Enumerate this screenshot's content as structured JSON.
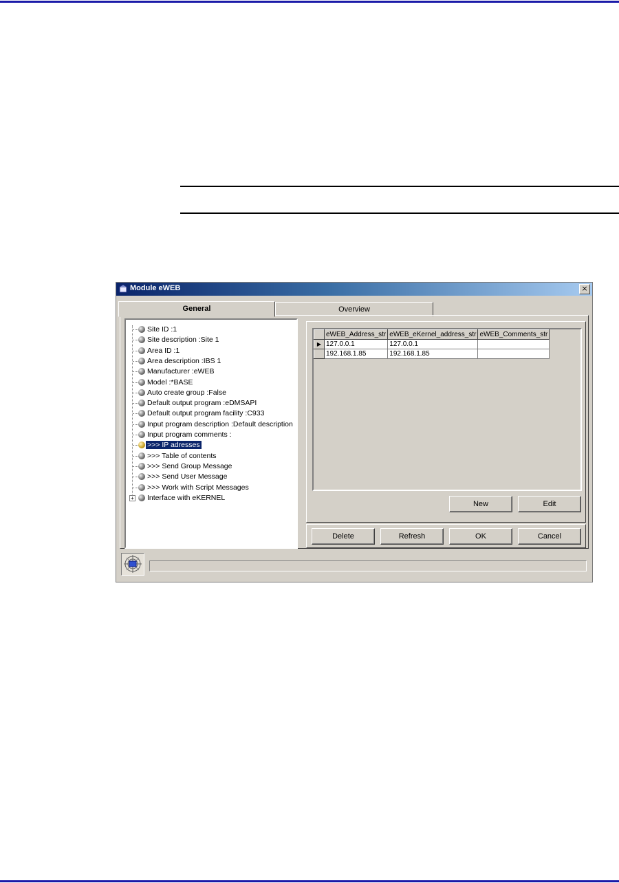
{
  "window": {
    "title": "Module eWEB",
    "close_glyph": "×"
  },
  "tabs": [
    {
      "label": "General",
      "active": true
    },
    {
      "label": "Overview",
      "active": false
    }
  ],
  "tree": {
    "items": [
      {
        "label": "Site ID :1"
      },
      {
        "label": "Site description :Site 1"
      },
      {
        "label": "Area ID :1"
      },
      {
        "label": "Area description :IBS 1"
      },
      {
        "label": "Manufacturer :eWEB"
      },
      {
        "label": "Model :*BASE"
      },
      {
        "label": "Auto create group :False"
      },
      {
        "label": "Default output program :eDMSAPI"
      },
      {
        "label": "Default output program facility :C933"
      },
      {
        "label": "Input program description :Default description"
      },
      {
        "label": "Input program comments :"
      },
      {
        "label": ">>> IP adresses",
        "selected": true
      },
      {
        "label": ">>> Table of contents"
      },
      {
        "label": ">>> Send Group Message"
      },
      {
        "label": ">>> Send User Message"
      },
      {
        "label": ">>> Work with Script Messages"
      },
      {
        "label": "Interface with eKERNEL",
        "expandable": true
      }
    ],
    "expand_glyph": "+"
  },
  "grid": {
    "columns": [
      "eWEB_Address_str",
      "eWEB_eKernel_address_str",
      "eWEB_Comments_str"
    ],
    "rows": [
      {
        "indicator": "▶",
        "cells": [
          "127.0.0.1",
          "127.0.0.1",
          ""
        ]
      },
      {
        "indicator": "",
        "cells": [
          "192.168.1.85",
          "192.168.1.85",
          ""
        ]
      }
    ]
  },
  "buttons": {
    "new": "New",
    "edit": "Edit",
    "delete": "Delete",
    "refresh": "Refresh",
    "ok": "OK",
    "cancel": "Cancel"
  },
  "colors": {
    "titlebar_start": "#0a246a",
    "titlebar_end": "#a6caf0",
    "face": "#d4d0c8",
    "selection": "#0a246a",
    "page_rule": "#1a1aa8"
  },
  "icons": {
    "window": "window-icon",
    "status": "radar-icon",
    "tree_node": "ball-icon"
  }
}
